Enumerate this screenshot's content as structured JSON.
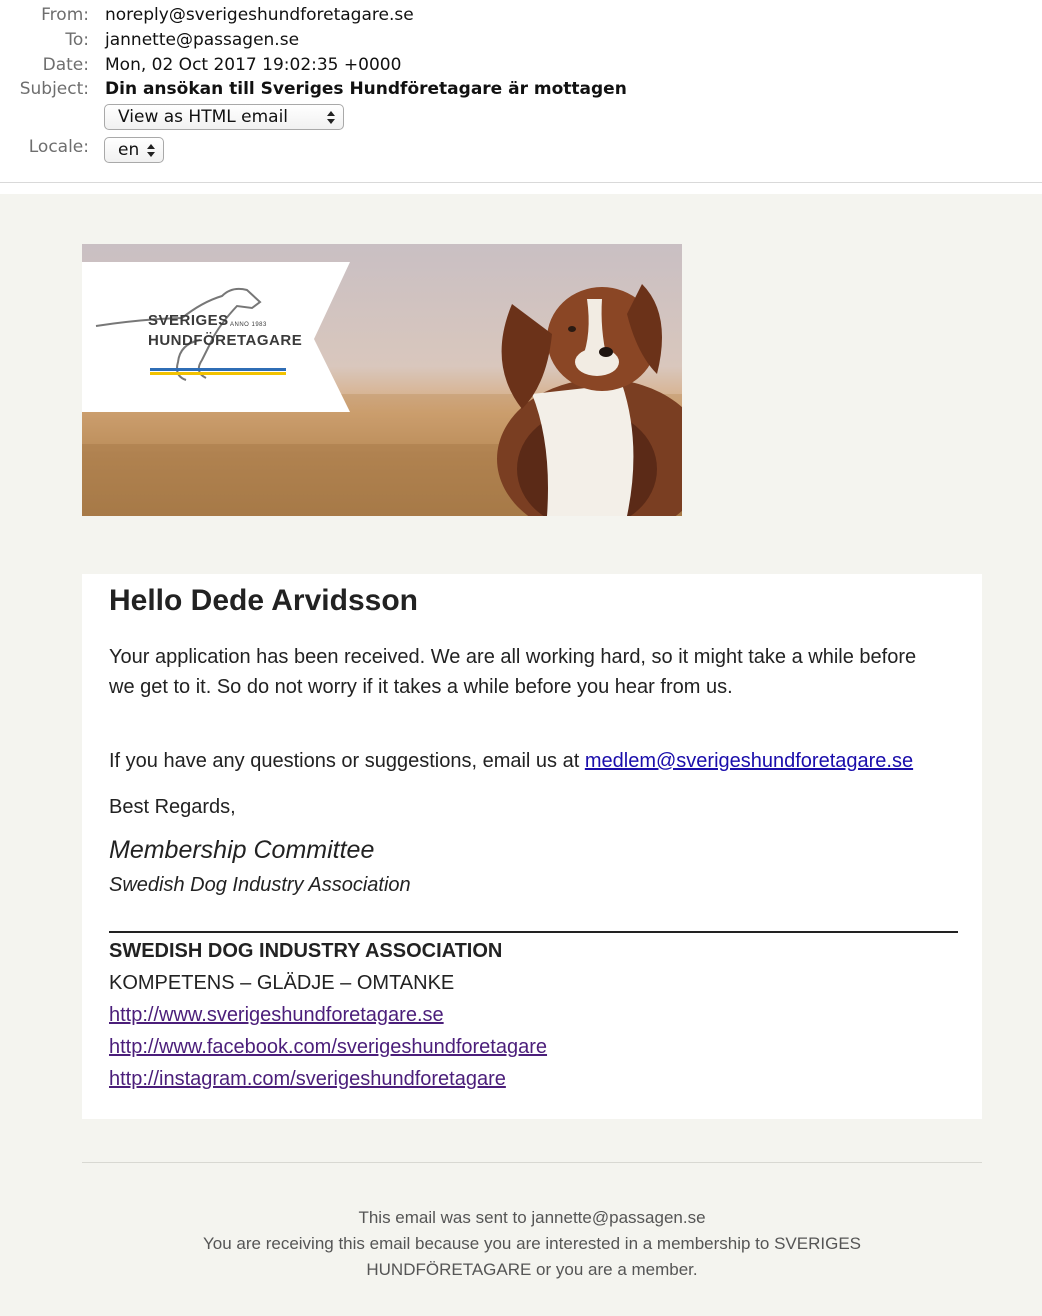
{
  "headers": {
    "from_label": "From:",
    "from": "noreply@sverigeshundforetagare.se",
    "to_label": "To:",
    "to": "jannette@passagen.se",
    "date_label": "Date:",
    "date": "Mon, 02 Oct 2017 19:02:35 +0000",
    "subject_label": "Subject:",
    "subject": "Din ansökan till Sveriges Hundföretagare är mottagen",
    "view_select": "View as HTML email",
    "locale_label": "Locale:",
    "locale_select": "en"
  },
  "banner": {
    "brand_line1": "SVERIGES",
    "brand_line2": "HUNDFÖRETAGARE",
    "brand_anno": "ANNO 1983"
  },
  "body": {
    "greeting": "Hello Dede Arvidsson",
    "para1": "Your application has been received. We are all working hard, so it might take a while before we get to it. So do not worry if it takes a while before you hear from us.",
    "para2_prefix": "If you have any questions or suggestions, email us at ",
    "contact_email": "medlem@sverigeshundforetagare.se",
    "regards": "Best Regards,",
    "sign_name": "Membership Committee",
    "sign_org": "Swedish Dog Industry Association"
  },
  "signature": {
    "org_title": "SWEDISH DOG INDUSTRY ASSOCIATION",
    "tagline": "KOMPETENS – GLÄDJE – OMTANKE",
    "links": [
      "http://www.sverigeshundforetagare.se",
      "http://www.facebook.com/sverigeshundforetagare",
      "http://instagram.com/sverigeshundforetagare"
    ]
  },
  "footer": {
    "line1": "This email was sent to jannette@passagen.se",
    "line2": "You are receiving this email because you are interested in a membership to SVERIGES HUNDFÖRETAGARE or you are a member."
  },
  "colors": {
    "email_background": "#f4f4ef",
    "link_blue": "#1a0dab",
    "link_visited": "#4b1e7a",
    "flag_blue": "#2f6db5",
    "flag_yellow": "#f2c200"
  }
}
